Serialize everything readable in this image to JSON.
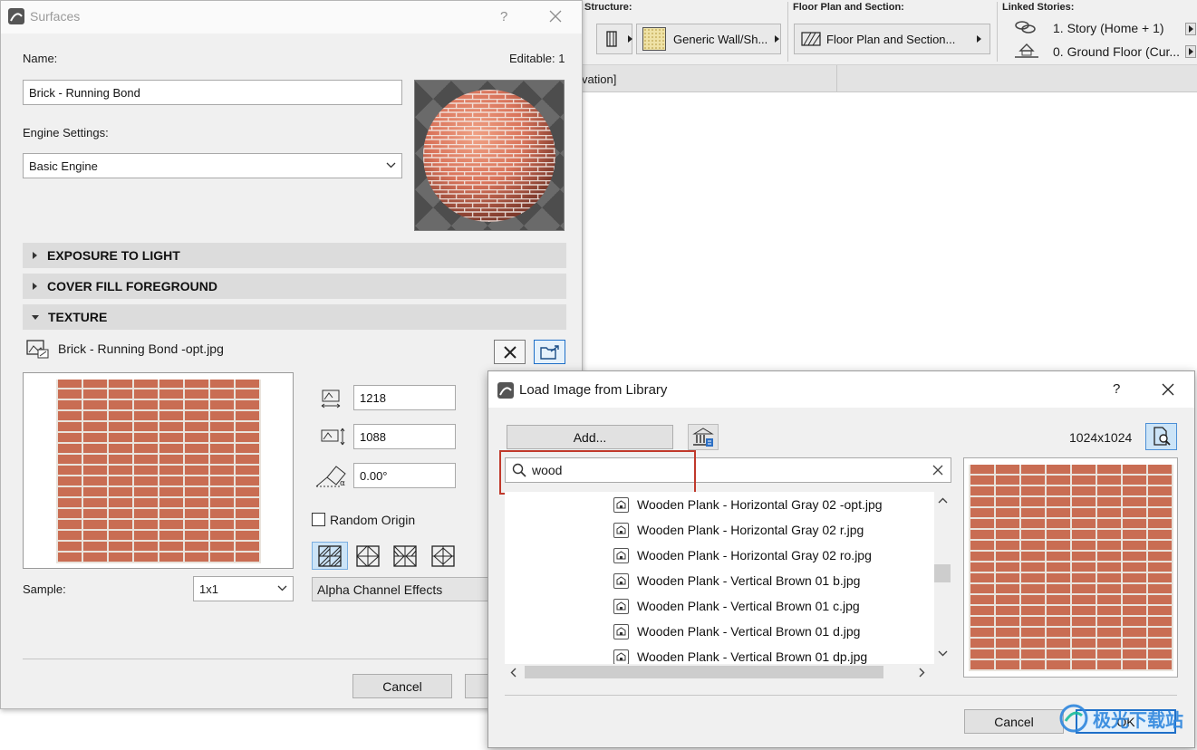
{
  "toolbar": {
    "structure_label": "Structure:",
    "structure_value": "Generic Wall/Sh...",
    "floor_plan_label": "Floor Plan and Section:",
    "floor_plan_value": "Floor Plan and Section...",
    "linked_label": "Linked Stories:",
    "linked_story_1": "1. Story (Home + 1)",
    "linked_story_0": "0. Ground Floor (Cur...",
    "tab_label": "vation]"
  },
  "surfaces": {
    "title": "Surfaces",
    "help": "?",
    "name_label": "Name:",
    "editable": "Editable: 1",
    "name_value": "Brick - Running Bond",
    "engine_label": "Engine Settings:",
    "engine_value": "Basic Engine",
    "sections": [
      "EXPOSURE TO LIGHT",
      "COVER FILL FOREGROUND",
      "TEXTURE"
    ],
    "texture_file": "Brick - Running Bond -opt.jpg",
    "width_value": "1218",
    "height_value": "1088",
    "angle_value": "0.00°",
    "random_origin": "Random Origin",
    "sample_label": "Sample:",
    "sample_value": "1x1",
    "alpha_value": "Alpha Channel Effects",
    "cancel": "Cancel"
  },
  "load_image": {
    "title": "Load Image from Library",
    "help": "?",
    "add": "Add...",
    "resolution": "1024x1024",
    "search_value": "wood",
    "files": [
      "Wooden Plank - Horizontal Gray 02 -opt.jpg",
      "Wooden Plank - Horizontal Gray 02 r.jpg",
      "Wooden Plank - Horizontal Gray 02 ro.jpg",
      "Wooden Plank - Vertical Brown 01 b.jpg",
      "Wooden Plank - Vertical Brown 01 c.jpg",
      "Wooden Plank - Vertical Brown 01 d.jpg",
      "Wooden Plank - Vertical Brown 01 dp.jpg"
    ],
    "cancel": "Cancel",
    "ok": "OK"
  },
  "watermark": "极光下载站",
  "colors": {
    "accent_blue": "#1e6fc8",
    "highlight_red": "#c0392b",
    "brick": "#c97157"
  }
}
